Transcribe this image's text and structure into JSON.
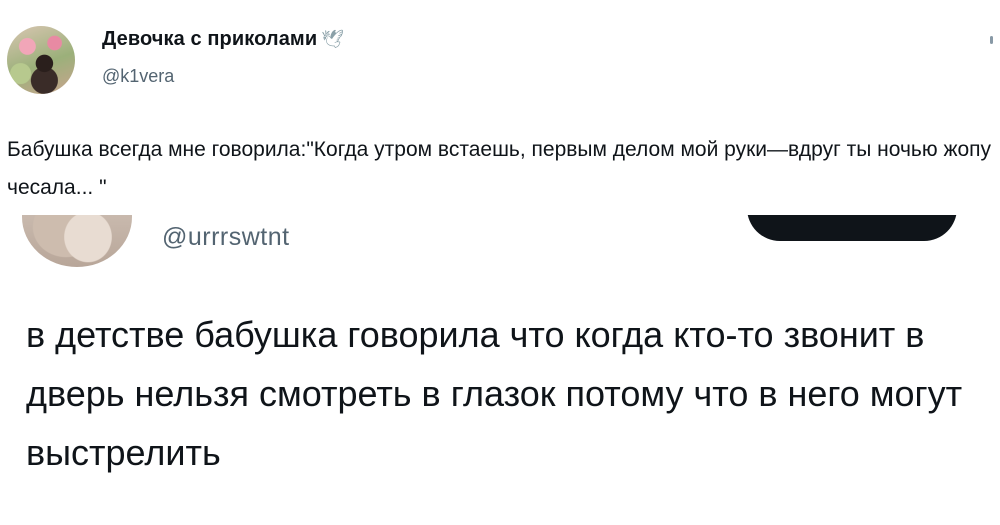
{
  "tweet_top": {
    "display_name": "Девочка с приколами",
    "badge_icon": "dove-icon",
    "handle": "@k1vera",
    "text": "Бабушка всегда мне говорила:\"Когда утром встаешь, первым делом мой руки—вдруг ты ночью жопу чесала... \""
  },
  "tweet_quoted": {
    "handle": "@urrrswtnt",
    "text": "в детстве бабушка говорила что когда кто-то звонит в дверь нельзя смотреть в глазок потому что в него могут выстрелить"
  },
  "colors": {
    "text_primary": "#0f1419",
    "text_secondary": "#536471",
    "background": "#ffffff",
    "button_dark": "#0f1419"
  }
}
